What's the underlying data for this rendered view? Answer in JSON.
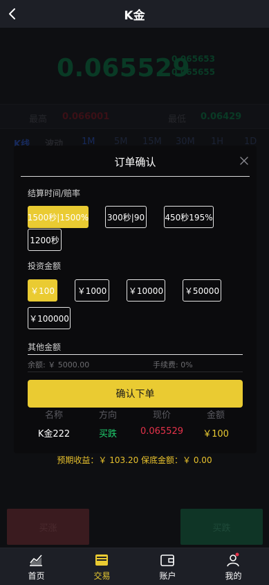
{
  "header": {
    "title": "K金"
  },
  "price": {
    "current": "0.065529",
    "sub_high": "0.065653",
    "sub_low": "0.065655"
  },
  "stats": {
    "high_label": "最高",
    "high_value": "0.066001",
    "low_label": "最低",
    "low_value": "0.06429"
  },
  "ktabs": [
    "K线",
    "波动",
    "1M",
    "5M",
    "15M",
    "30M",
    "1H",
    "1D"
  ],
  "modal": {
    "title": "订单确认",
    "settle_label": "结算时间/赔率",
    "settle_options": [
      "1500秒|1500%",
      "300秒|90",
      "450秒195%",
      "1200秒"
    ],
    "settle_selected": 0,
    "invest_label": "投资金额",
    "invest_options": [
      "￥100",
      "￥1000",
      "￥10000",
      "￥50000",
      "￥100000"
    ],
    "invest_selected": 0,
    "other_label": "其他金额",
    "balance": "余额: ￥ 5000.00",
    "fee": "手续费: 0%",
    "confirm_label": "确认下单",
    "summary": {
      "headers": [
        "名称",
        "方向",
        "现价",
        "金额"
      ],
      "values": [
        "K金222",
        "买跌",
        "0.065529",
        "￥100"
      ]
    }
  },
  "expected": "预期收益：￥ 103.20   保底金额：￥ 0.00",
  "buttons": {
    "buy_up": "买涨",
    "buy_down": "买跌"
  },
  "nav": [
    {
      "label": "首页",
      "icon": "chart-icon"
    },
    {
      "label": "交易",
      "icon": "trade-icon"
    },
    {
      "label": "账户",
      "icon": "wallet-icon"
    },
    {
      "label": "我的",
      "icon": "user-icon"
    }
  ],
  "nav_active": 1,
  "colors": {
    "accent": "#eacb32",
    "green": "#1fcf6e",
    "red": "#e5324a"
  }
}
